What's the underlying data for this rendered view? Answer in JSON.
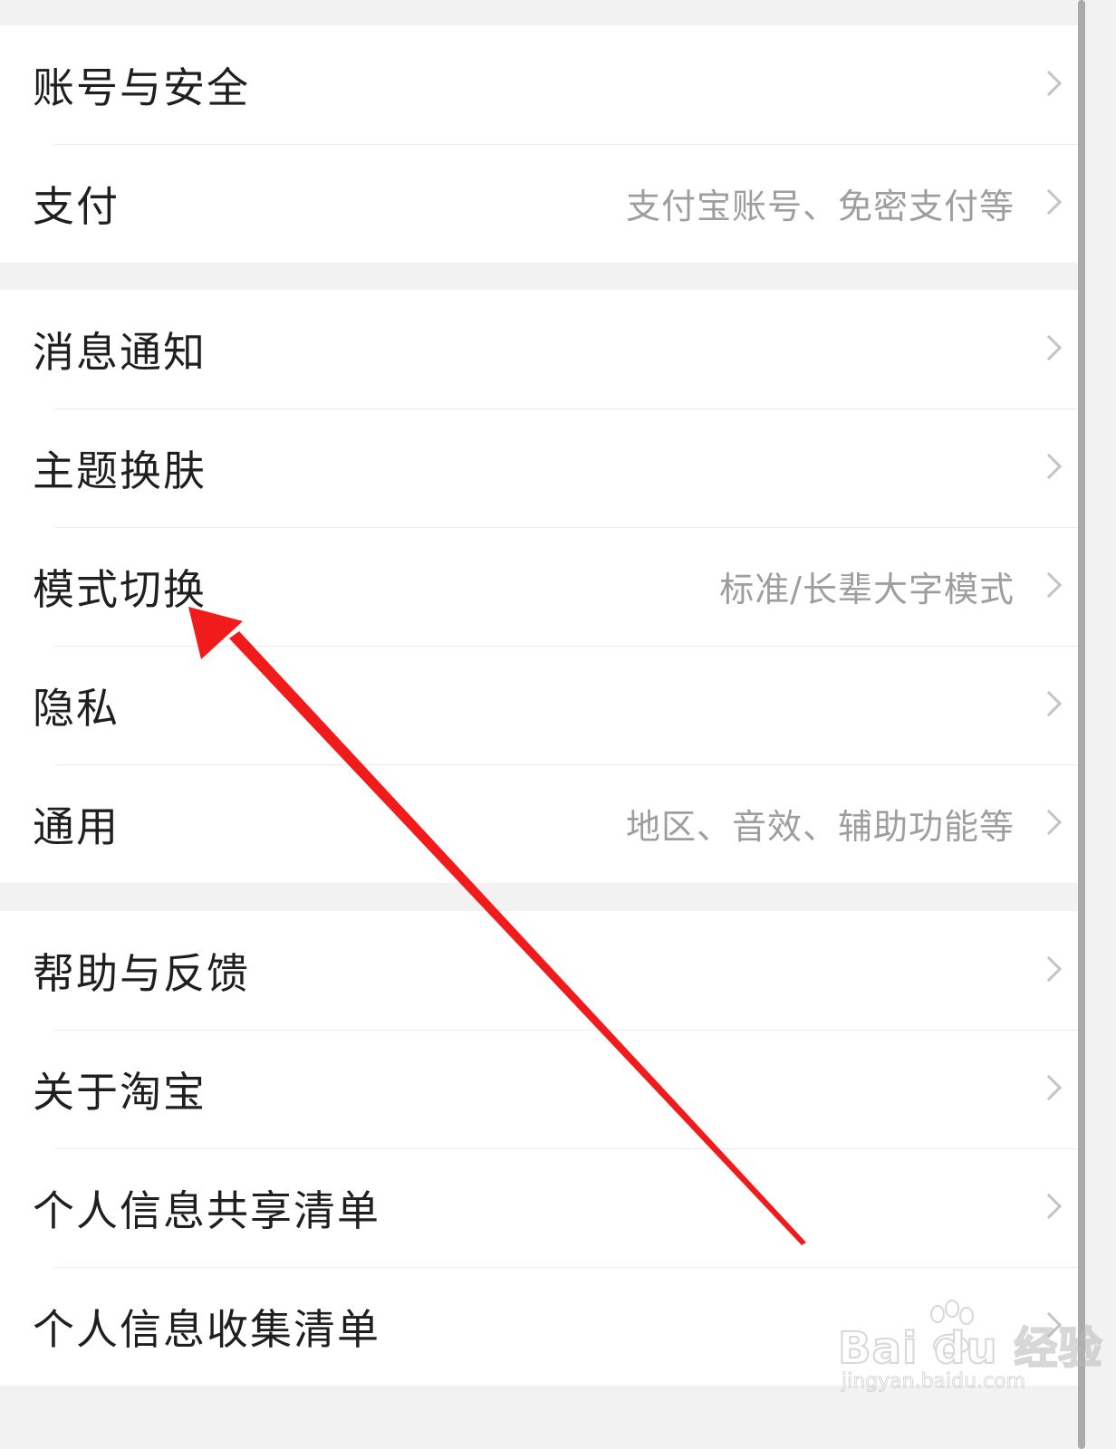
{
  "settings": {
    "group1": [
      {
        "label": "账号与安全",
        "sub": ""
      },
      {
        "label": "支付",
        "sub": "支付宝账号、免密支付等"
      }
    ],
    "group2": [
      {
        "label": "消息通知",
        "sub": ""
      },
      {
        "label": "主题换肤",
        "sub": ""
      },
      {
        "label": "模式切换",
        "sub": "标准/长辈大字模式"
      },
      {
        "label": "隐私",
        "sub": ""
      },
      {
        "label": "通用",
        "sub": "地区、音效、辅助功能等"
      }
    ],
    "group3": [
      {
        "label": "帮助与反馈",
        "sub": ""
      },
      {
        "label": "关于淘宝",
        "sub": ""
      },
      {
        "label": "个人信息共享清单",
        "sub": ""
      },
      {
        "label": "个人信息收集清单",
        "sub": ""
      }
    ]
  },
  "annotation": {
    "arrow_color": "#f21b1b"
  },
  "watermark": {
    "brand": "Bai du 经验",
    "url": "jingyan.baidu.com"
  },
  "colors": {
    "background": "#f2f2f2",
    "row": "#ffffff",
    "label": "#1f1f1f",
    "sub": "#9e9e9e",
    "chevron": "#c4c4c4"
  }
}
